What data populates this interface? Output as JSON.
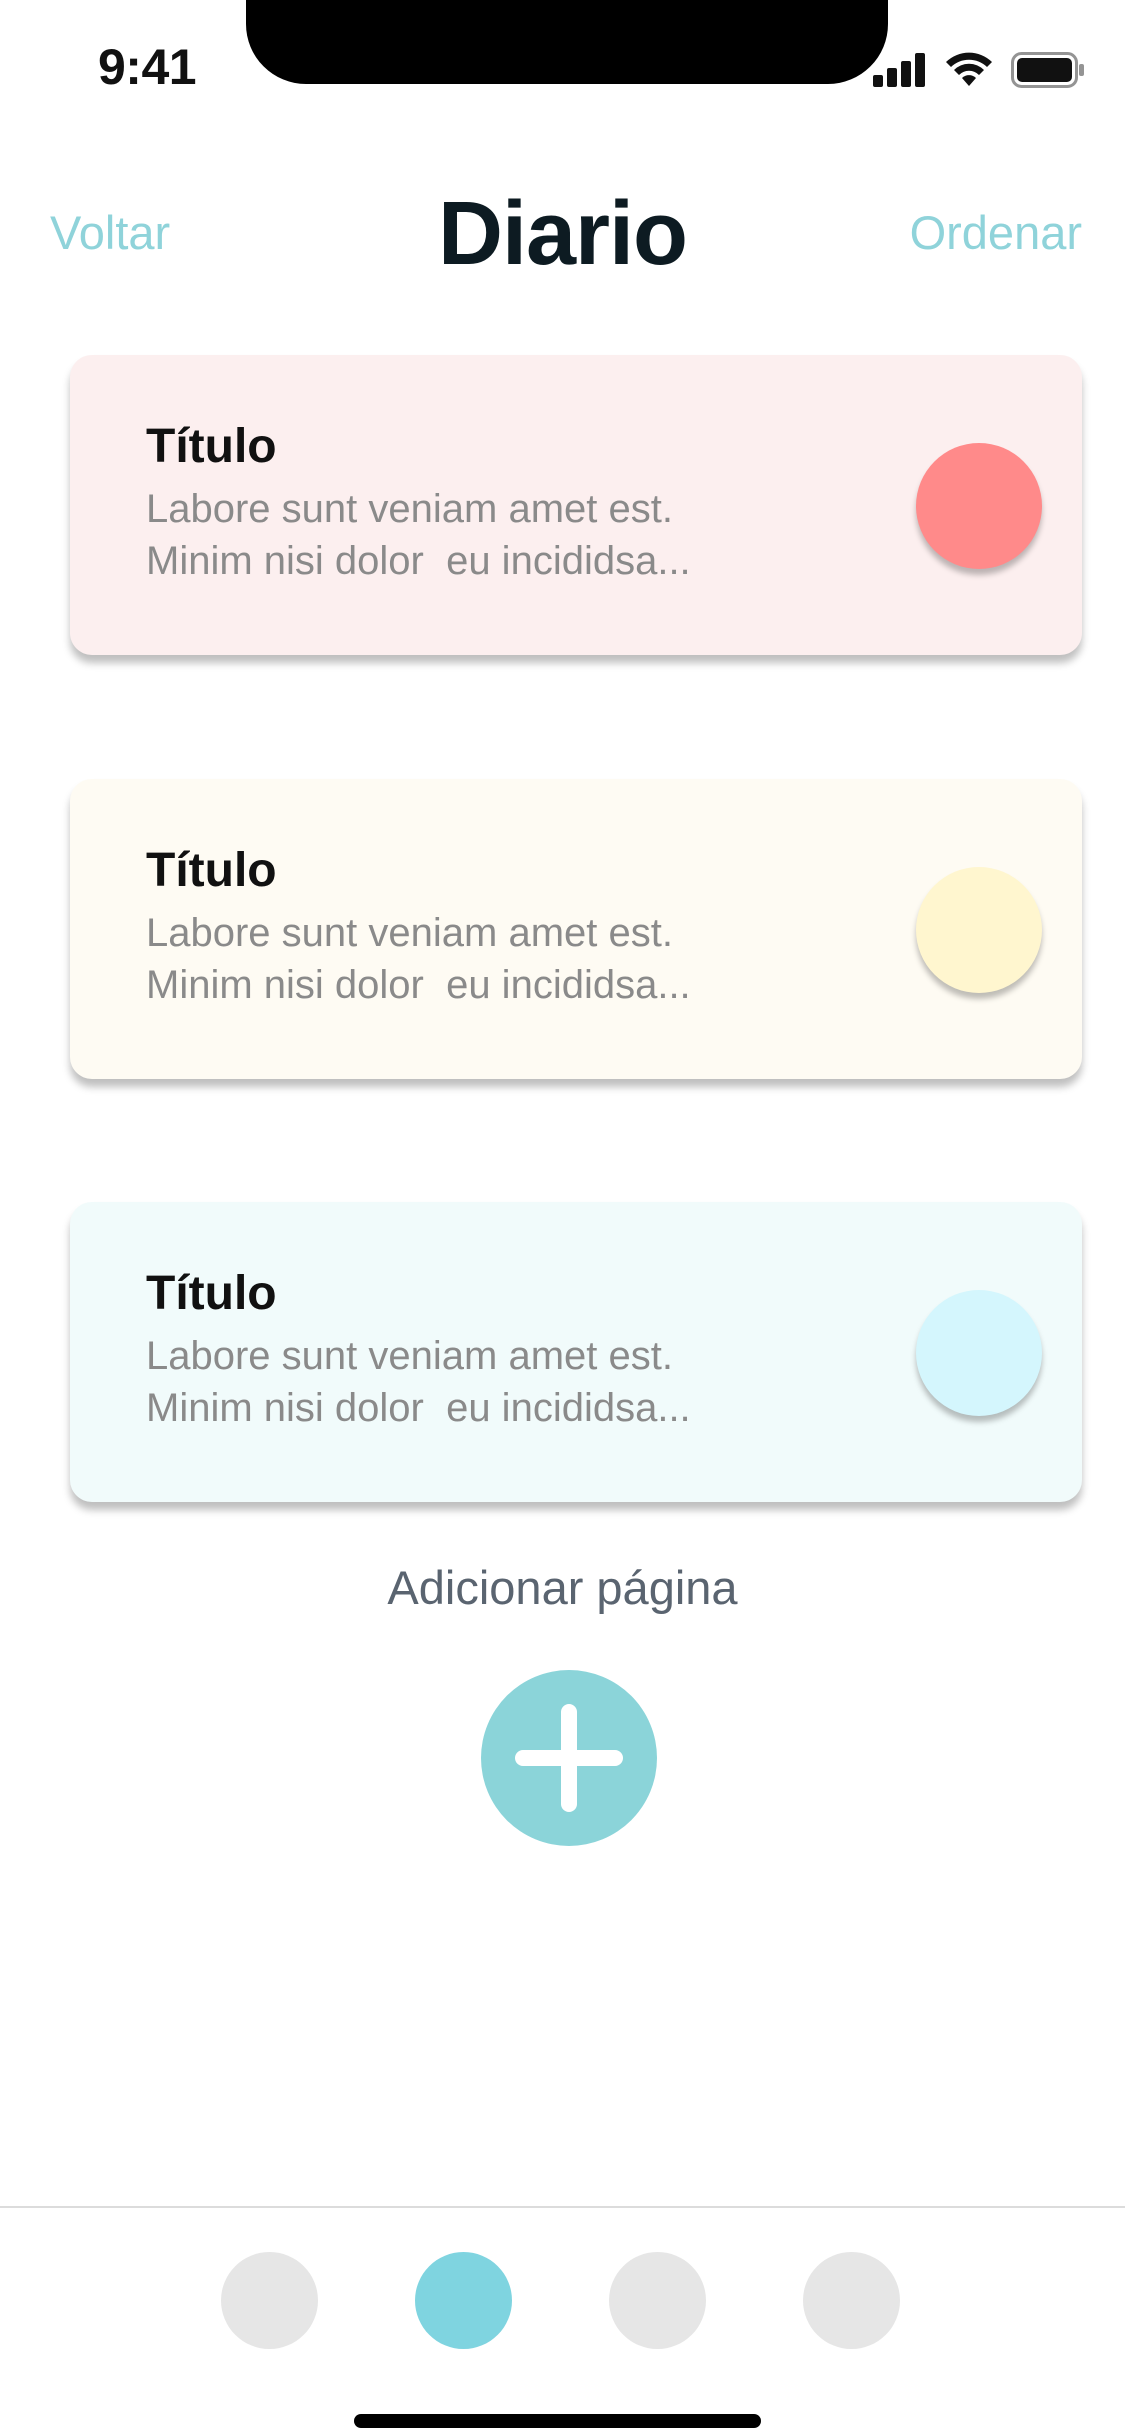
{
  "status_bar": {
    "time": "9:41",
    "icons": [
      "signal-icon",
      "wifi-icon",
      "battery-icon"
    ]
  },
  "nav": {
    "back_label": "Voltar",
    "title": "Diario",
    "sort_label": "Ordenar"
  },
  "cards": [
    {
      "title": "Título",
      "line1": "Labore sunt veniam amet est.",
      "line2": "Minim nisi dolor  eu incididsa...",
      "bg_color": "#fcefef",
      "dot_color": "#ff8a8a"
    },
    {
      "title": "Título",
      "line1": "Labore sunt veniam amet est.",
      "line2": "Minim nisi dolor  eu incididsa...",
      "bg_color": "#fefbf3",
      "dot_color": "#fff6cf"
    },
    {
      "title": "Título",
      "line1": "Labore sunt veniam amet est.",
      "line2": "Minim nisi dolor  eu incididsa...",
      "bg_color": "#f1fbfb",
      "dot_color": "#d4f6fd"
    }
  ],
  "add_page": {
    "label": "Adicionar página",
    "icon": "plus-icon",
    "color": "#8bd4d9"
  },
  "tab_bar": {
    "active_index": 1,
    "active_color": "#7fd4e0",
    "inactive_color": "#e6e6e6",
    "tabs": [
      "tab-1",
      "tab-2",
      "tab-3",
      "tab-4"
    ]
  },
  "colors": {
    "accent": "#8fd3da",
    "title": "#0d1b22"
  }
}
